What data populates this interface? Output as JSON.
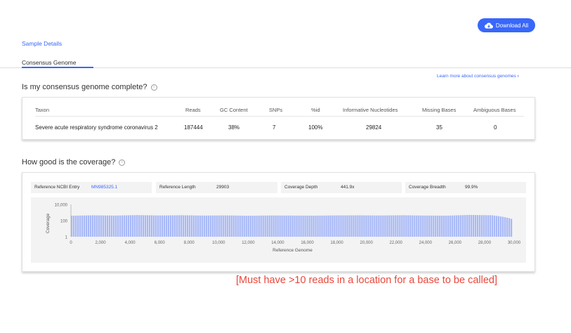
{
  "header": {
    "download_label": "Download All",
    "download_icon": "cloud-download-icon",
    "sample_details_label": "Sample Details",
    "tab_label": "Consensus Genome",
    "learn_more_label": "Learn more about consensus genomes",
    "accent_color": "#3867fa"
  },
  "completeness": {
    "title": "Is my consensus genome complete?",
    "info_icon": "i",
    "columns": [
      "Taxon",
      "Reads",
      "GC Content",
      "SNPs",
      "%id",
      "Informative Nucleotides",
      "Missing Bases",
      "Ambiguous Bases"
    ],
    "row": [
      "Severe acute respiratory syndrome coronavirus 2",
      "187444",
      "38%",
      "7",
      "100%",
      "29824",
      "35",
      "0"
    ]
  },
  "coverage": {
    "title": "How good is the coverage?",
    "info_icon": "i",
    "ref_entry_label": "Reference NCBI Entry",
    "ref_entry_value": "MN985325.1",
    "ref_length_label": "Reference Length",
    "ref_length_value": "29903",
    "depth_label": "Coverage Depth",
    "depth_value": "441.9x",
    "breadth_label": "Coverage Breadth",
    "breadth_value": "99.9%"
  },
  "chart_data": {
    "type": "area",
    "xlabel": "Reference Genome",
    "ylabel": "Coverage",
    "y_scale": "log",
    "ylim": [
      1,
      10000
    ],
    "xlim": [
      0,
      30000
    ],
    "y_ticks": [
      "1",
      "100",
      "10,000"
    ],
    "y_tick_values": [
      1,
      100,
      10000
    ],
    "x_ticks": [
      "0",
      "2,000",
      "4,000",
      "6,000",
      "8,000",
      "10,000",
      "12,000",
      "14,000",
      "16,000",
      "18,000",
      "20,000",
      "22,000",
      "24,000",
      "26,000",
      "28,000",
      "30,000"
    ],
    "x_tick_values": [
      0,
      2000,
      4000,
      6000,
      8000,
      10000,
      12000,
      14000,
      16000,
      18000,
      20000,
      22000,
      24000,
      26000,
      28000,
      30000
    ],
    "series_color": "#a7b8f7",
    "x": [
      0,
      1500,
      3000,
      4500,
      6000,
      7500,
      9000,
      10500,
      12000,
      13500,
      15000,
      16500,
      18000,
      19500,
      21000,
      22500,
      24000,
      25500,
      27000,
      28500,
      29903
    ],
    "values": [
      400,
      450,
      420,
      480,
      430,
      460,
      420,
      440,
      400,
      430,
      420,
      410,
      440,
      450,
      430,
      460,
      420,
      410,
      500,
      460,
      150
    ]
  },
  "annotation": {
    "text": "[Must have >10 reads in a location for a base to be called]",
    "color": "#e8483c"
  }
}
